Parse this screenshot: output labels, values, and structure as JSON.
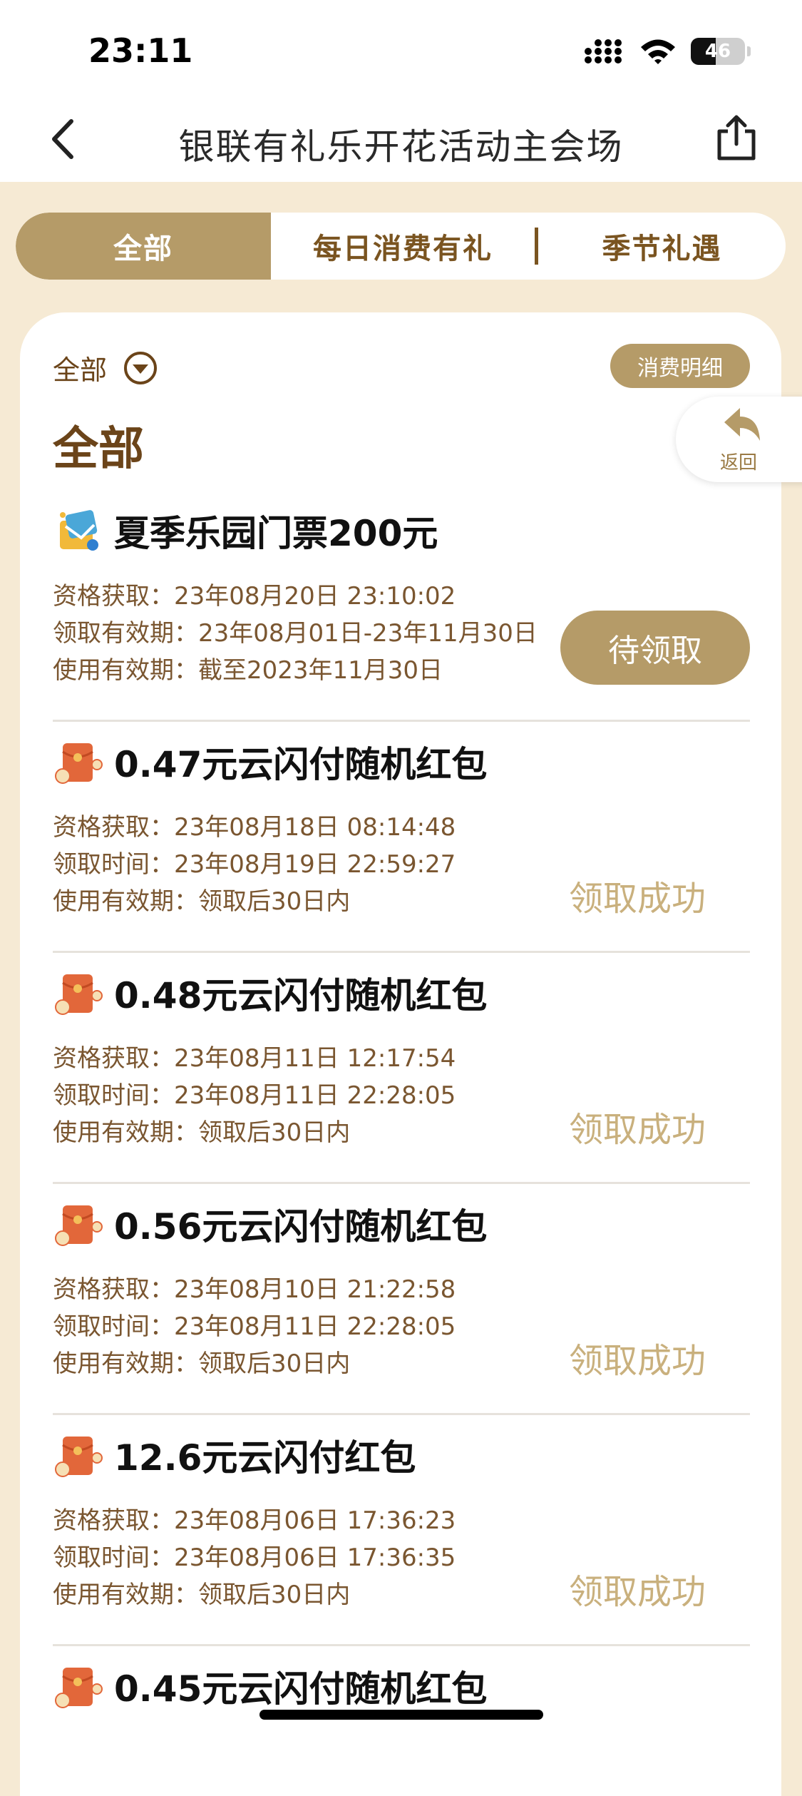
{
  "status_bar": {
    "time": "23:11",
    "battery_level": "46",
    "battery_fraction": 0.46
  },
  "nav": {
    "title": "银联有礼乐开花活动主会场"
  },
  "tabs": [
    {
      "label": "全部",
      "active": true
    },
    {
      "label": "每日消费有礼",
      "active": false
    },
    {
      "label": "季节礼遇",
      "active": false
    }
  ],
  "filter": {
    "label": "全部"
  },
  "detail_button": {
    "label": "消费明细"
  },
  "section_title": "全部",
  "back_float": {
    "label": "返回"
  },
  "colors": {
    "accent": "#b59b68",
    "brown": "#6b4419",
    "success": "#c9b07d",
    "page_bg": "#f6ead4"
  },
  "items": [
    {
      "icon": "ticket-gift-icon",
      "title": "夏季乐园门票200元",
      "lines": [
        "资格获取：23年08月20日 23:10:02",
        "领取有效期：23年08月01日-23年11月30日",
        "使用有效期：截至2023年11月30日"
      ],
      "action": "待领取"
    },
    {
      "icon": "red-envelope-icon",
      "title": "0.47元云闪付随机红包",
      "lines": [
        "资格获取：23年08月18日 08:14:48",
        "领取时间：23年08月19日 22:59:27",
        "使用有效期：领取后30日内"
      ],
      "status": "领取成功"
    },
    {
      "icon": "red-envelope-icon",
      "title": "0.48元云闪付随机红包",
      "lines": [
        "资格获取：23年08月11日 12:17:54",
        "领取时间：23年08月11日 22:28:05",
        "使用有效期：领取后30日内"
      ],
      "status": "领取成功"
    },
    {
      "icon": "red-envelope-icon",
      "title": "0.56元云闪付随机红包",
      "lines": [
        "资格获取：23年08月10日 21:22:58",
        "领取时间：23年08月11日 22:28:05",
        "使用有效期：领取后30日内"
      ],
      "status": "领取成功"
    },
    {
      "icon": "red-envelope-icon",
      "title": "12.6元云闪付红包",
      "lines": [
        "资格获取：23年08月06日 17:36:23",
        "领取时间：23年08月06日 17:36:35",
        "使用有效期：领取后30日内"
      ],
      "status": "领取成功"
    },
    {
      "icon": "red-envelope-icon",
      "title": "0.45元云闪付随机红包"
    }
  ]
}
